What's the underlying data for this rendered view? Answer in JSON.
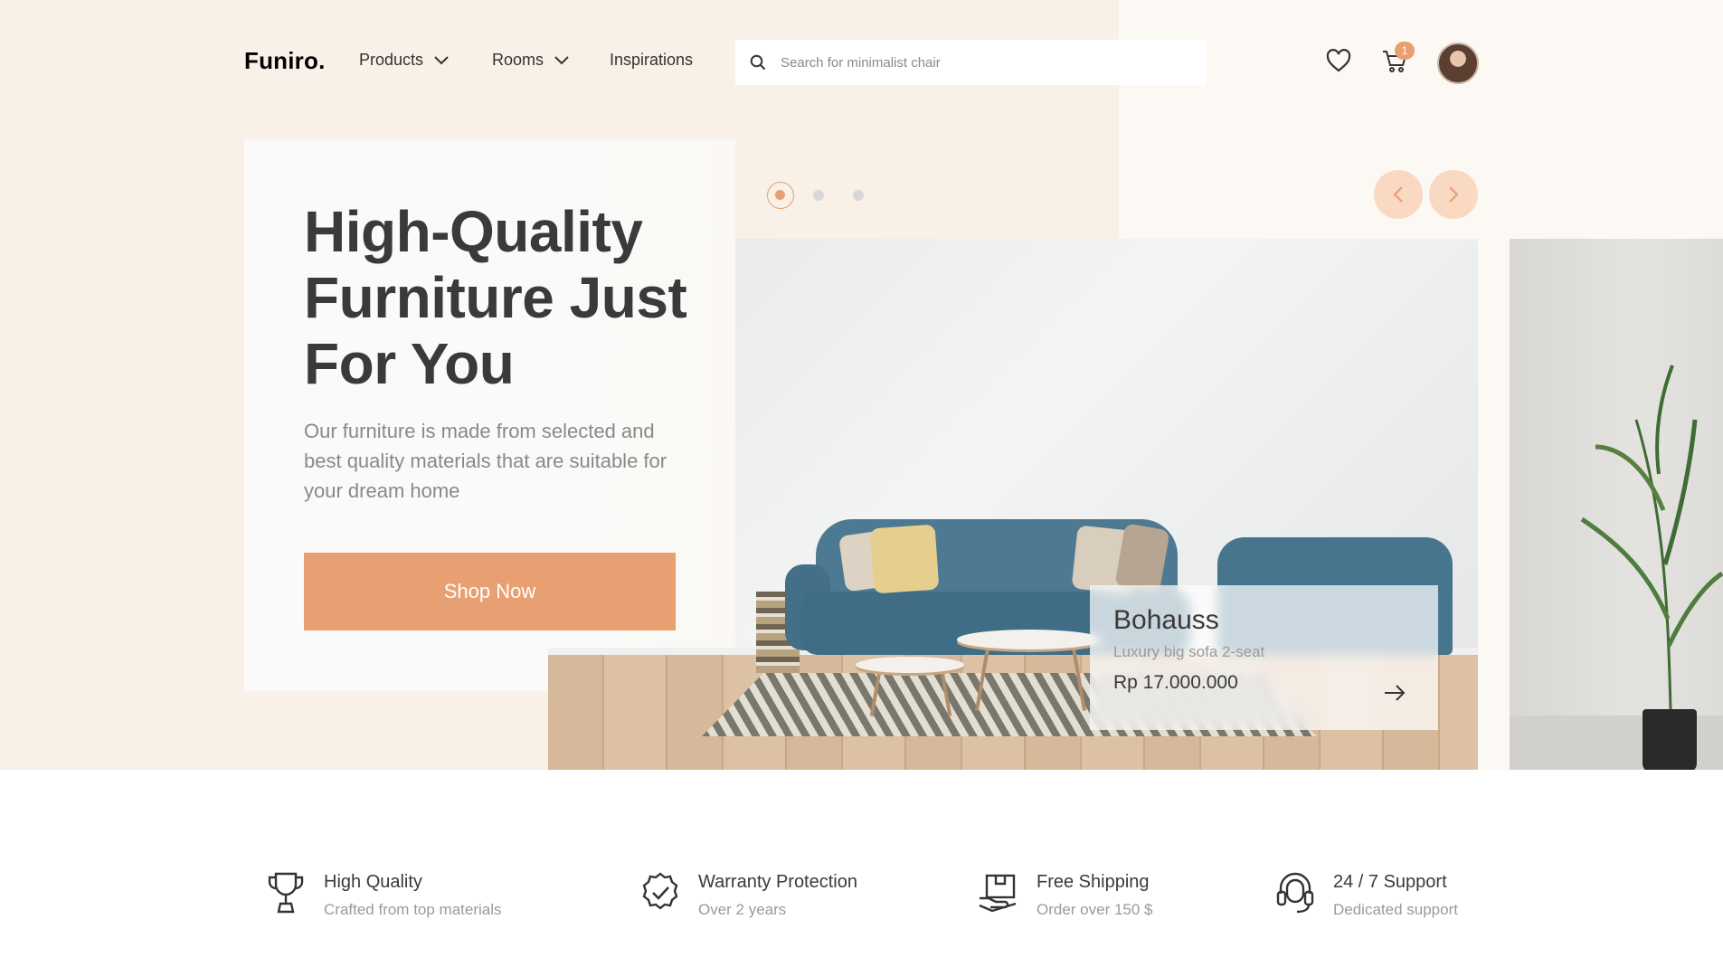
{
  "brand": {
    "logo": "Funiro."
  },
  "nav": {
    "products": "Products",
    "rooms": "Rooms",
    "inspirations": "Inspirations"
  },
  "search": {
    "placeholder": "Search for minimalist chair",
    "icon": "search-icon"
  },
  "header_icons": {
    "wishlist": "heart-icon",
    "cart": "cart-icon",
    "cart_count": "1"
  },
  "hero": {
    "title": "High-Quality Furniture Just For You",
    "description": "Our furniture is made from selected and best quality materials that are suitable for your dream home",
    "cta": "Shop Now"
  },
  "slider": {
    "slide_count": 3,
    "active_index": 0
  },
  "product": {
    "name": "Bohauss",
    "subtitle": "Luxury big sofa 2-seat",
    "price": "Rp 17.000.000"
  },
  "features": [
    {
      "icon": "trophy-icon",
      "title": "High Quality",
      "subtitle": "Crafted from top materials"
    },
    {
      "icon": "badge-check-icon",
      "title": "Warranty Protection",
      "subtitle": "Over 2 years"
    },
    {
      "icon": "shipping-icon",
      "title": "Free Shipping",
      "subtitle": "Order over 150 $"
    },
    {
      "icon": "support-icon",
      "title": "24 / 7 Support",
      "subtitle": "Dedicated support"
    }
  ],
  "colors": {
    "accent": "#E89F71",
    "hero_bg": "#F9F0E7",
    "card_bg": "#FBFAF8",
    "text_dark": "#3A3A3A",
    "text_muted": "#898989"
  }
}
